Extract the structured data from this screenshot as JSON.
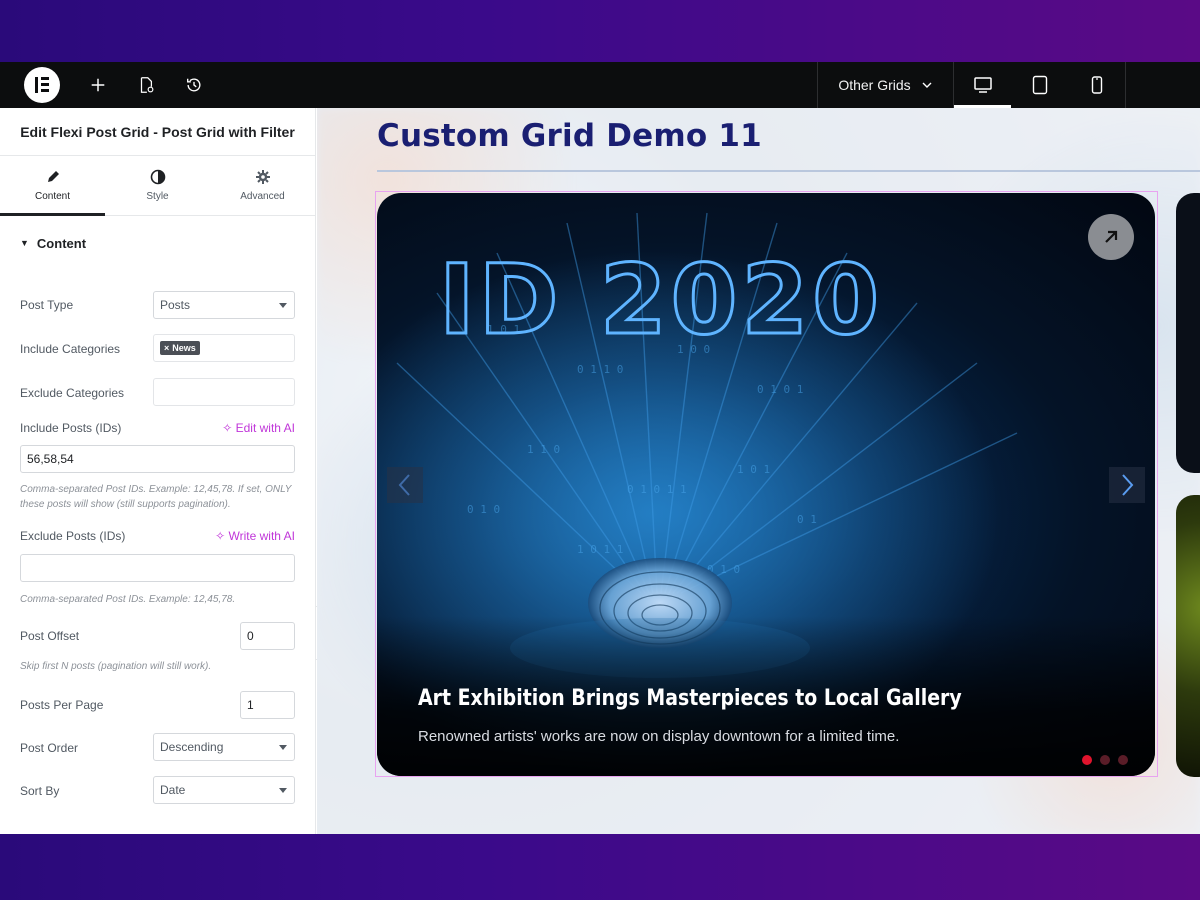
{
  "topbar": {
    "grids_label": "Other Grids"
  },
  "panel": {
    "title": "Edit Flexi Post Grid - Post Grid with Filter",
    "tabs": [
      {
        "label": "Content"
      },
      {
        "label": "Style"
      },
      {
        "label": "Advanced"
      }
    ],
    "section_title": "Content",
    "post_type": {
      "label": "Post Type",
      "value": "Posts"
    },
    "include_categories": {
      "label": "Include Categories",
      "tag": "News"
    },
    "exclude_categories": {
      "label": "Exclude Categories",
      "value": ""
    },
    "include_posts": {
      "label": "Include Posts (IDs)",
      "ai_label": "Edit with AI",
      "value": "56,58,54",
      "hint": "Comma-separated Post IDs. Example: 12,45,78. If set, ONLY these posts will show (still supports pagination)."
    },
    "exclude_posts": {
      "label": "Exclude Posts (IDs)",
      "ai_label": "Write with AI",
      "value": "",
      "hint": "Comma-separated Post IDs. Example: 12,45,78."
    },
    "post_offset": {
      "label": "Post Offset",
      "value": "0",
      "hint": "Skip first N posts (pagination will still work)."
    },
    "posts_per_page": {
      "label": "Posts Per Page",
      "value": "1"
    },
    "post_order": {
      "label": "Post Order",
      "value": "Descending"
    },
    "sort_by": {
      "label": "Sort By",
      "value": "Date"
    }
  },
  "preview": {
    "page_title": "Custom Grid Demo 11",
    "card": {
      "image_text": "ID 2020",
      "title": "Art Exhibition Brings Masterpieces to Local Gallery",
      "excerpt": "Renowned artists' works are now on display downtown for a limited time.",
      "slides_total": 3,
      "active_slide": 1
    }
  },
  "colors": {
    "accent_ai": "#c036d9",
    "title_navy": "#1a1f72",
    "dot_active": "#e0142d",
    "topbar_bg": "#0c0d0e"
  }
}
